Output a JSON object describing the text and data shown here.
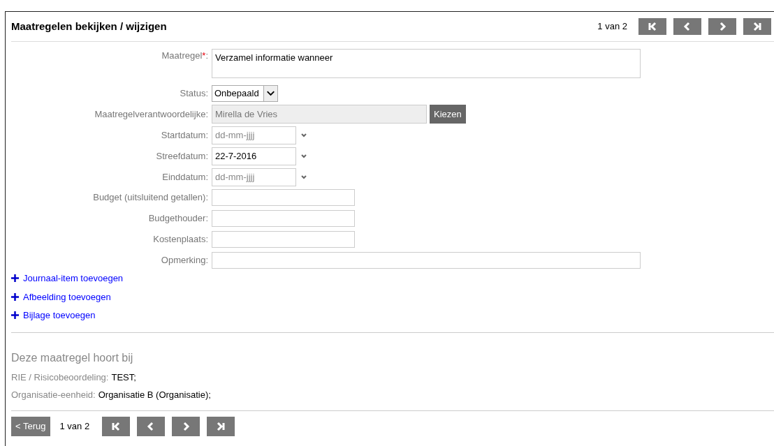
{
  "header": {
    "title": "Maatregelen bekijken / wijzigen",
    "page_info": "1 van 2"
  },
  "fields": [
    {
      "kind": "textarea",
      "label": "Maatregel",
      "required_mark": "*",
      "label_end": ":",
      "value": "Verzamel informatie wanneer"
    },
    {
      "kind": "select",
      "label": "Status:",
      "value": "Onbepaald"
    },
    {
      "kind": "picker",
      "label": "Maatregelverantwoordelijke:",
      "value": "Mirella de Vries",
      "disabled": true,
      "button": "Kiezen"
    },
    {
      "kind": "date",
      "label": "Startdatum:",
      "placeholder": "dd-mm-jjjj"
    },
    {
      "kind": "date",
      "label": "Streefdatum:",
      "value": "22-7-2016"
    },
    {
      "kind": "date",
      "label": "Einddatum:",
      "placeholder": "dd-mm-jjjj"
    },
    {
      "kind": "text",
      "label": "Budget (uitsluitend getallen):"
    },
    {
      "kind": "text",
      "label": "Budgethouder:"
    },
    {
      "kind": "text",
      "label": "Kostenplaats:"
    },
    {
      "kind": "wide",
      "label": "Opmerking:"
    }
  ],
  "add_links": [
    "Journaal-item toevoegen",
    "Afbeelding toevoegen",
    "Bijlage toevoegen"
  ],
  "belongs_to": {
    "heading": "Deze maatregel hoort bij",
    "items": [
      {
        "label": "RIE / Risicobeoordeling:",
        "value": "TEST;"
      },
      {
        "label": "Organisatie-eenheid:",
        "value": "Organisatie B (Organisatie);"
      }
    ]
  },
  "footer": {
    "back": "< Terug",
    "page_info": "1 van 2"
  }
}
